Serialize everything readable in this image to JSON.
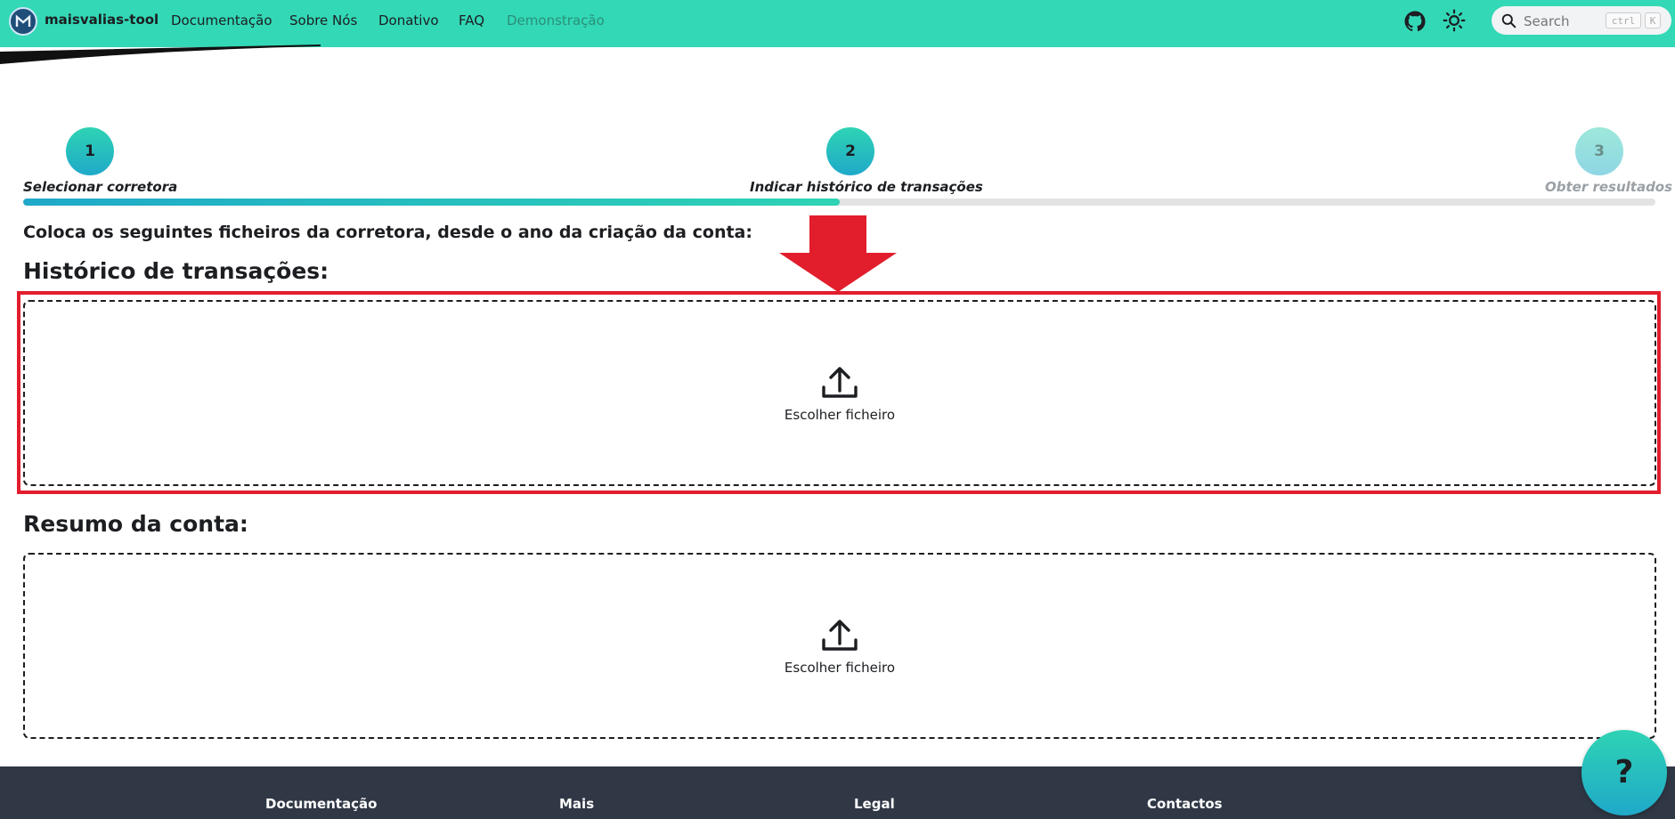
{
  "navbar": {
    "brand": "maisvalias-tool",
    "links": [
      "Documentação",
      "Sobre Nós",
      "Donativo",
      "FAQ",
      "Demonstração"
    ],
    "search": {
      "placeholder": "Search",
      "shortcut_keys": [
        "ctrl",
        "K"
      ]
    },
    "icons": [
      "github-icon",
      "sun-icon",
      "search-icon"
    ]
  },
  "stepper": {
    "progress_percent": 50,
    "steps": [
      {
        "number": "1",
        "label": "Selecionar corretora",
        "state": "done"
      },
      {
        "number": "2",
        "label": "Indicar histórico de transações",
        "state": "active"
      },
      {
        "number": "3",
        "label": "Obter resultados",
        "state": "inactive"
      }
    ]
  },
  "main": {
    "instructions": "Coloca os seguintes ficheiros da corretora, desde o ano da criação da conta:",
    "sections": [
      {
        "title": "Histórico de transações:",
        "upload_label": "Escolher ficheiro",
        "highlighted": true
      },
      {
        "title": "Resumo da conta:",
        "upload_label": "Escolher ficheiro",
        "highlighted": false
      }
    ]
  },
  "footer": {
    "columns": [
      "Documentação",
      "Mais",
      "Legal",
      "Contactos"
    ]
  },
  "help_button": {
    "label": "?"
  },
  "colors": {
    "accent": "#33d8b6",
    "accent_dark": "#1fa9c9",
    "annotation_red": "#e21d2c",
    "footer_bg": "#303846"
  }
}
